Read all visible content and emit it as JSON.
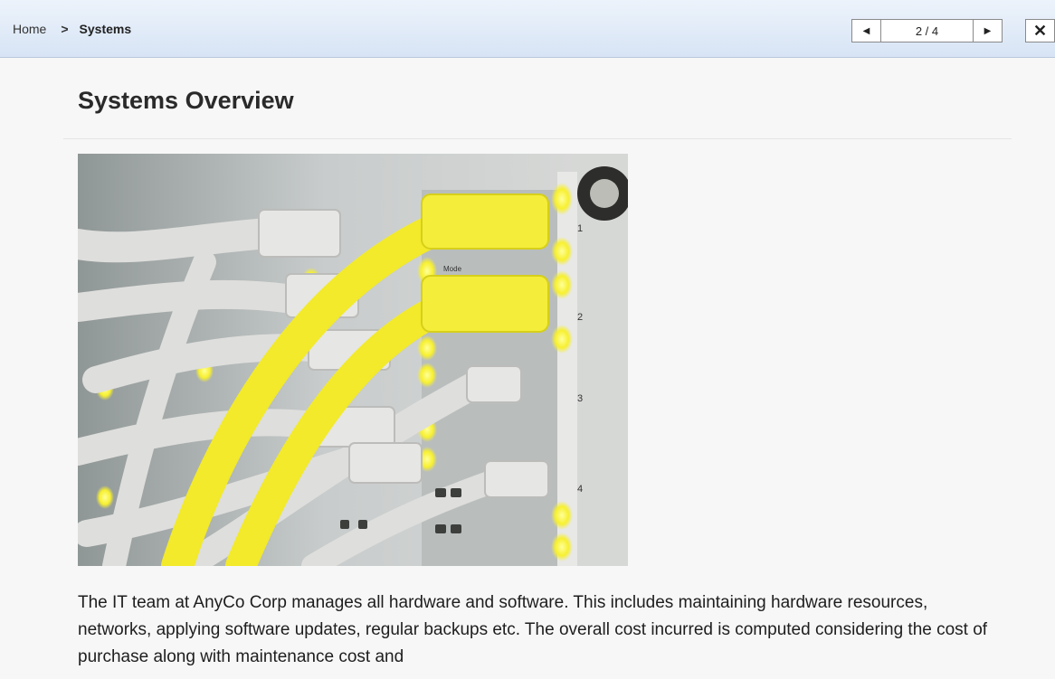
{
  "breadcrumb": {
    "home": "Home",
    "separator": ">",
    "current": "Systems"
  },
  "pager": {
    "prev_icon": "caret-left-icon",
    "next_icon": "caret-right-icon",
    "prev_glyph": "◀",
    "next_glyph": "▶",
    "position": "2 / 4",
    "close_icon": "close-icon",
    "close_glyph": "✕"
  },
  "page": {
    "title": "Systems Overview",
    "image_alt": "network cables plugged into a switch",
    "description": "The IT team at AnyCo Corp manages all hardware and software. This includes maintaining hardware resources, networks, applying software updates, regular backups etc. The overall cost incurred is computed considering the cost of purchase along with maintenance cost and"
  },
  "colors": {
    "header_top": "#edf3fb",
    "header_bottom": "#d7e4f5",
    "cable_yellow": "#f4ee3a",
    "cable_gray": "#dcdcdc"
  }
}
